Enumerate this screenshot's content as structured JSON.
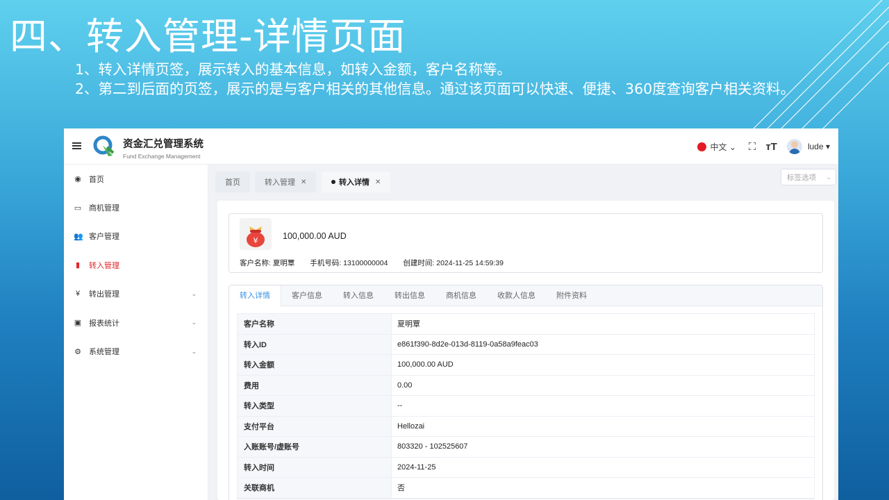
{
  "slide": {
    "title": "四、转入管理-详情页面",
    "desc_line1": "1、转入详情页签，展示转入的基本信息，如转入金额，客户名称等。",
    "desc_line2": "2、第二到后面的页签，展示的是与客户相关的其他信息。通过该页面可以快速、便捷、360度查询客户相关资料。"
  },
  "header": {
    "menu_icon": "hamburger-icon",
    "app_title": "资金汇兑管理系统",
    "app_subtitle": "Fund Exchange Management",
    "language": "中文",
    "fullscreen_icon": "fullscreen-icon",
    "font_size_icon": "font-size-icon",
    "username": "lude"
  },
  "sidebar": {
    "items": [
      {
        "icon": "dashboard-icon",
        "label": "首页"
      },
      {
        "icon": "opportunity-icon",
        "label": "商机管理"
      },
      {
        "icon": "customers-icon",
        "label": "客户管理"
      },
      {
        "icon": "transfer-in-icon",
        "label": "转入管理"
      },
      {
        "icon": "yen-icon",
        "label": "转出管理"
      },
      {
        "icon": "report-icon",
        "label": "报表统计"
      },
      {
        "icon": "settings-icon",
        "label": "系统管理"
      }
    ]
  },
  "tabs": {
    "items": [
      {
        "label": "首页"
      },
      {
        "label": "转入管理"
      },
      {
        "label": "转入详情"
      }
    ],
    "options_label": "标签选项"
  },
  "summary": {
    "amount": "100,000.00 AUD",
    "customer": "客户名称: 夏明覃",
    "phone": "手机号码: 13100000004",
    "created": "创建时间: 2024-11-25 14:59:39"
  },
  "detail_tabs": [
    "转入详情",
    "客户信息",
    "转入信息",
    "转出信息",
    "商机信息",
    "收款人信息",
    "附件资料"
  ],
  "details": [
    {
      "label": "客户名称",
      "value": "夏明覃"
    },
    {
      "label": "转入ID",
      "value": "e861f390-8d2e-013d-8119-0a58a9feac03"
    },
    {
      "label": "转入金额",
      "value": "100,000.00 AUD"
    },
    {
      "label": "费用",
      "value": "0.00"
    },
    {
      "label": "转入类型",
      "value": "--"
    },
    {
      "label": "支付平台",
      "value": "Hellozai"
    },
    {
      "label": "入账账号/虚账号",
      "value": "803320 - 102525607"
    },
    {
      "label": "转入时间",
      "value": "2024-11-25"
    },
    {
      "label": "关联商机",
      "value": "否"
    }
  ],
  "colors": {
    "active_menu": "#e0262b",
    "active_detail_tab": "#3c8fe0"
  }
}
